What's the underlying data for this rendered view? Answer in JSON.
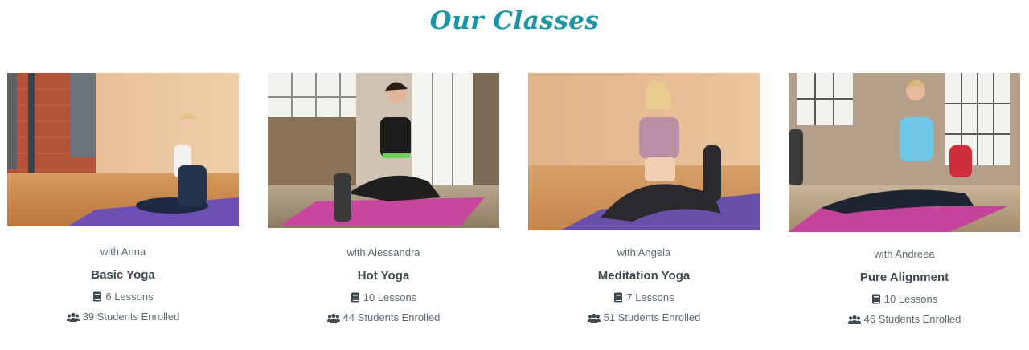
{
  "section": {
    "title": "Our Classes"
  },
  "classes": [
    {
      "instructor": "with Anna",
      "name": "Basic Yoga",
      "lessons": "6 Lessons",
      "students": "39 Students Enrolled",
      "photo_icon": "yoga-photo"
    },
    {
      "instructor": "with Alessandra",
      "name": "Hot Yoga",
      "lessons": "10 Lessons",
      "students": "44 Students Enrolled",
      "photo_icon": "yoga-photo"
    },
    {
      "instructor": "with Angela",
      "name": "Meditation Yoga",
      "lessons": "7 Lessons",
      "students": "51 Students Enrolled",
      "photo_icon": "yoga-photo"
    },
    {
      "instructor": "with Andreea",
      "name": "Pure Alignment",
      "lessons": "10 Lessons",
      "students": "46 Students Enrolled",
      "photo_icon": "yoga-photo"
    }
  ],
  "icons": {
    "lessons": "book-icon",
    "students": "users-icon"
  },
  "colors": {
    "title": "#1a95a6",
    "heading": "#3d4a4e",
    "text": "#5f6b6f"
  }
}
